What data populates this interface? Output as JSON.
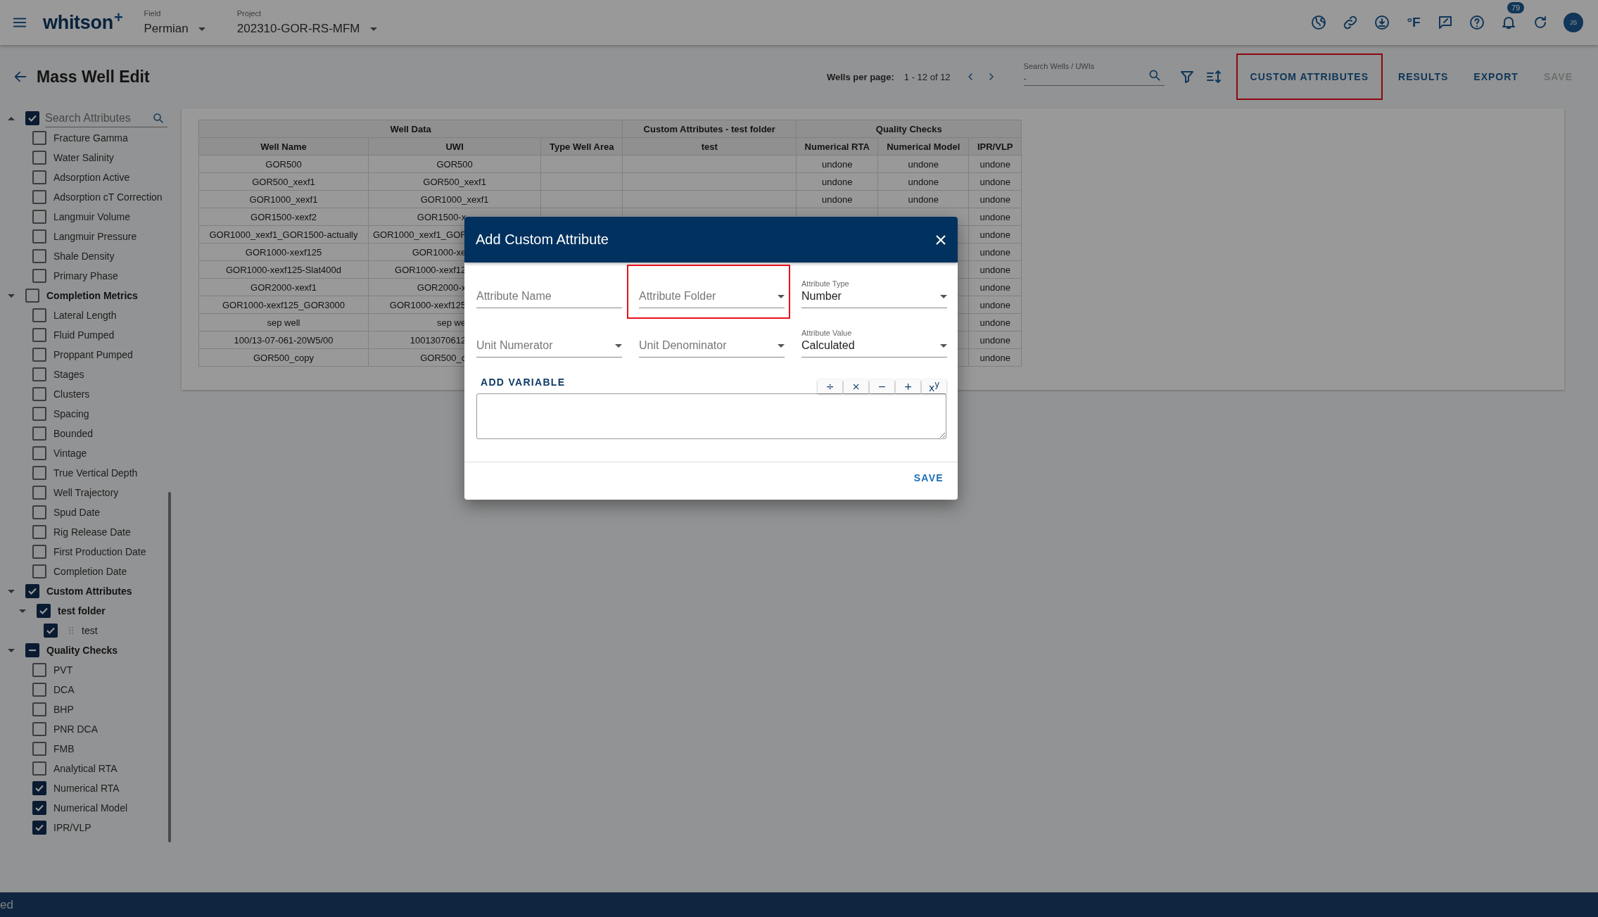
{
  "app_bar": {
    "logo": "whitson",
    "logo_mark": "+",
    "field": {
      "label": "Field",
      "value": "Permian"
    },
    "project": {
      "label": "Project",
      "value": "202310-GOR-RS-MFM"
    },
    "unit_label": "°F",
    "notification_count": "79",
    "avatar_initials": "JS"
  },
  "page": {
    "title": "Mass Well Edit",
    "pagination": {
      "label": "Wells per page:",
      "range": "1 - 12 of 12"
    },
    "search": {
      "label": "Search Wells / UWIs",
      "placeholder": "-"
    },
    "actions": [
      {
        "label": "CUSTOM ATTRIBUTES",
        "disabled": false,
        "highlighted": true
      },
      {
        "label": "RESULTS",
        "disabled": false,
        "highlighted": false
      },
      {
        "label": "EXPORT",
        "disabled": false,
        "highlighted": false
      },
      {
        "label": "SAVE",
        "disabled": true,
        "highlighted": false
      }
    ]
  },
  "sidebar": {
    "search": {
      "placeholder": "Search Attributes",
      "checked": true,
      "expanded": true
    },
    "items": [
      {
        "label": "Fracture Gamma",
        "checked": false
      },
      {
        "label": "Water Salinity",
        "checked": false
      },
      {
        "label": "Adsorption Active",
        "checked": false
      },
      {
        "label": "Adsorption cT Correction",
        "checked": false
      },
      {
        "label": "Langmuir Volume",
        "checked": false
      },
      {
        "label": "Langmuir Pressure",
        "checked": false
      },
      {
        "label": "Shale Density",
        "checked": false
      },
      {
        "label": "Primary Phase",
        "checked": false
      }
    ],
    "groups": [
      {
        "label": "Completion Metrics",
        "checked": false,
        "expanded": true,
        "children": [
          {
            "label": "Lateral Length",
            "checked": false
          },
          {
            "label": "Fluid Pumped",
            "checked": false
          },
          {
            "label": "Proppant Pumped",
            "checked": false
          },
          {
            "label": "Stages",
            "checked": false
          },
          {
            "label": "Clusters",
            "checked": false
          },
          {
            "label": "Spacing",
            "checked": false
          },
          {
            "label": "Bounded",
            "checked": false
          },
          {
            "label": "Vintage",
            "checked": false
          },
          {
            "label": "True Vertical Depth",
            "checked": false
          },
          {
            "label": "Well Trajectory",
            "checked": false
          },
          {
            "label": "Spud Date",
            "checked": false
          },
          {
            "label": "Rig Release Date",
            "checked": false
          },
          {
            "label": "First Production Date",
            "checked": false
          },
          {
            "label": "Completion Date",
            "checked": false
          }
        ]
      },
      {
        "label": "Custom Attributes",
        "checked": true,
        "expanded": true,
        "children": [
          {
            "label": "test folder",
            "checked": true,
            "expanded": true,
            "children": [
              {
                "label": "test",
                "checked": true,
                "draggable": true
              }
            ]
          }
        ]
      },
      {
        "label": "Quality Checks",
        "indeterminate": true,
        "expanded": true,
        "children": [
          {
            "label": "PVT",
            "checked": false
          },
          {
            "label": "DCA",
            "checked": false
          },
          {
            "label": "BHP",
            "checked": false
          },
          {
            "label": "PNR DCA",
            "checked": false
          },
          {
            "label": "FMB",
            "checked": false
          },
          {
            "label": "Analytical RTA",
            "checked": false
          },
          {
            "label": "Numerical RTA",
            "checked": true
          },
          {
            "label": "Numerical Model",
            "checked": true
          },
          {
            "label": "IPR/VLP",
            "checked": true
          }
        ]
      }
    ]
  },
  "table": {
    "groups": [
      {
        "label": "Well Data",
        "columns": [
          "Well Name",
          "UWI",
          "Type Well Area"
        ]
      },
      {
        "label": "Custom Attributes - test folder",
        "columns": [
          "test"
        ]
      },
      {
        "label": "Quality Checks",
        "columns": [
          "Numerical RTA",
          "Numerical Model",
          "IPR/VLP"
        ]
      }
    ],
    "rows": [
      [
        "GOR500",
        "GOR500",
        null,
        null,
        "undone",
        "undone",
        "undone"
      ],
      [
        "GOR500_xexf1",
        "GOR500_xexf1",
        null,
        null,
        "undone",
        "undone",
        "undone"
      ],
      [
        "GOR1000_xexf1",
        "GOR1000_xexf1",
        null,
        null,
        "undone",
        "undone",
        "undone"
      ],
      [
        "GOR1500-xexf2",
        "GOR1500-x",
        null,
        null,
        null,
        null,
        "undone"
      ],
      [
        "GOR1000_xexf1_GOR1500-actually",
        "GOR1000_xexf1_GOF",
        null,
        null,
        null,
        null,
        "undone"
      ],
      [
        "GOR1000-xexf125",
        "GOR1000-xe",
        null,
        null,
        null,
        null,
        "undone"
      ],
      [
        "GOR1000-xexf125-Slat400d",
        "GOR1000-xexf12",
        null,
        null,
        null,
        null,
        "undone"
      ],
      [
        "GOR2000-xexf1",
        "GOR2000-x",
        null,
        null,
        null,
        null,
        "undone"
      ],
      [
        "GOR1000-xexf125_GOR3000",
        "GOR1000-xexf125",
        null,
        null,
        null,
        null,
        "undone"
      ],
      [
        "sep well",
        "sep we",
        null,
        null,
        null,
        null,
        "undone"
      ],
      [
        "100/13-07-061-20W5/00",
        "10013070612",
        null,
        null,
        null,
        null,
        "undone"
      ],
      [
        "GOR500_copy",
        "GOR500_c",
        null,
        null,
        null,
        null,
        "undone"
      ]
    ]
  },
  "dialog": {
    "title": "Add Custom Attribute",
    "fields": [
      {
        "label": "Attribute Name",
        "kind": "text"
      },
      {
        "label": "Attribute Folder",
        "kind": "select",
        "highlighted": true
      },
      {
        "label": "Attribute Type",
        "value": "Number",
        "kind": "select"
      },
      {
        "label": "Unit Numerator",
        "kind": "select"
      },
      {
        "label": "Unit Denominator",
        "kind": "select"
      },
      {
        "label": "Attribute Value",
        "value": "Calculated",
        "kind": "select"
      }
    ],
    "add_variable": "ADD VARIABLE",
    "operators": [
      "÷",
      "×",
      "−",
      "+",
      "x$^{y}$"
    ],
    "save": "SAVE"
  },
  "status_bar": {
    "text": "ed"
  }
}
